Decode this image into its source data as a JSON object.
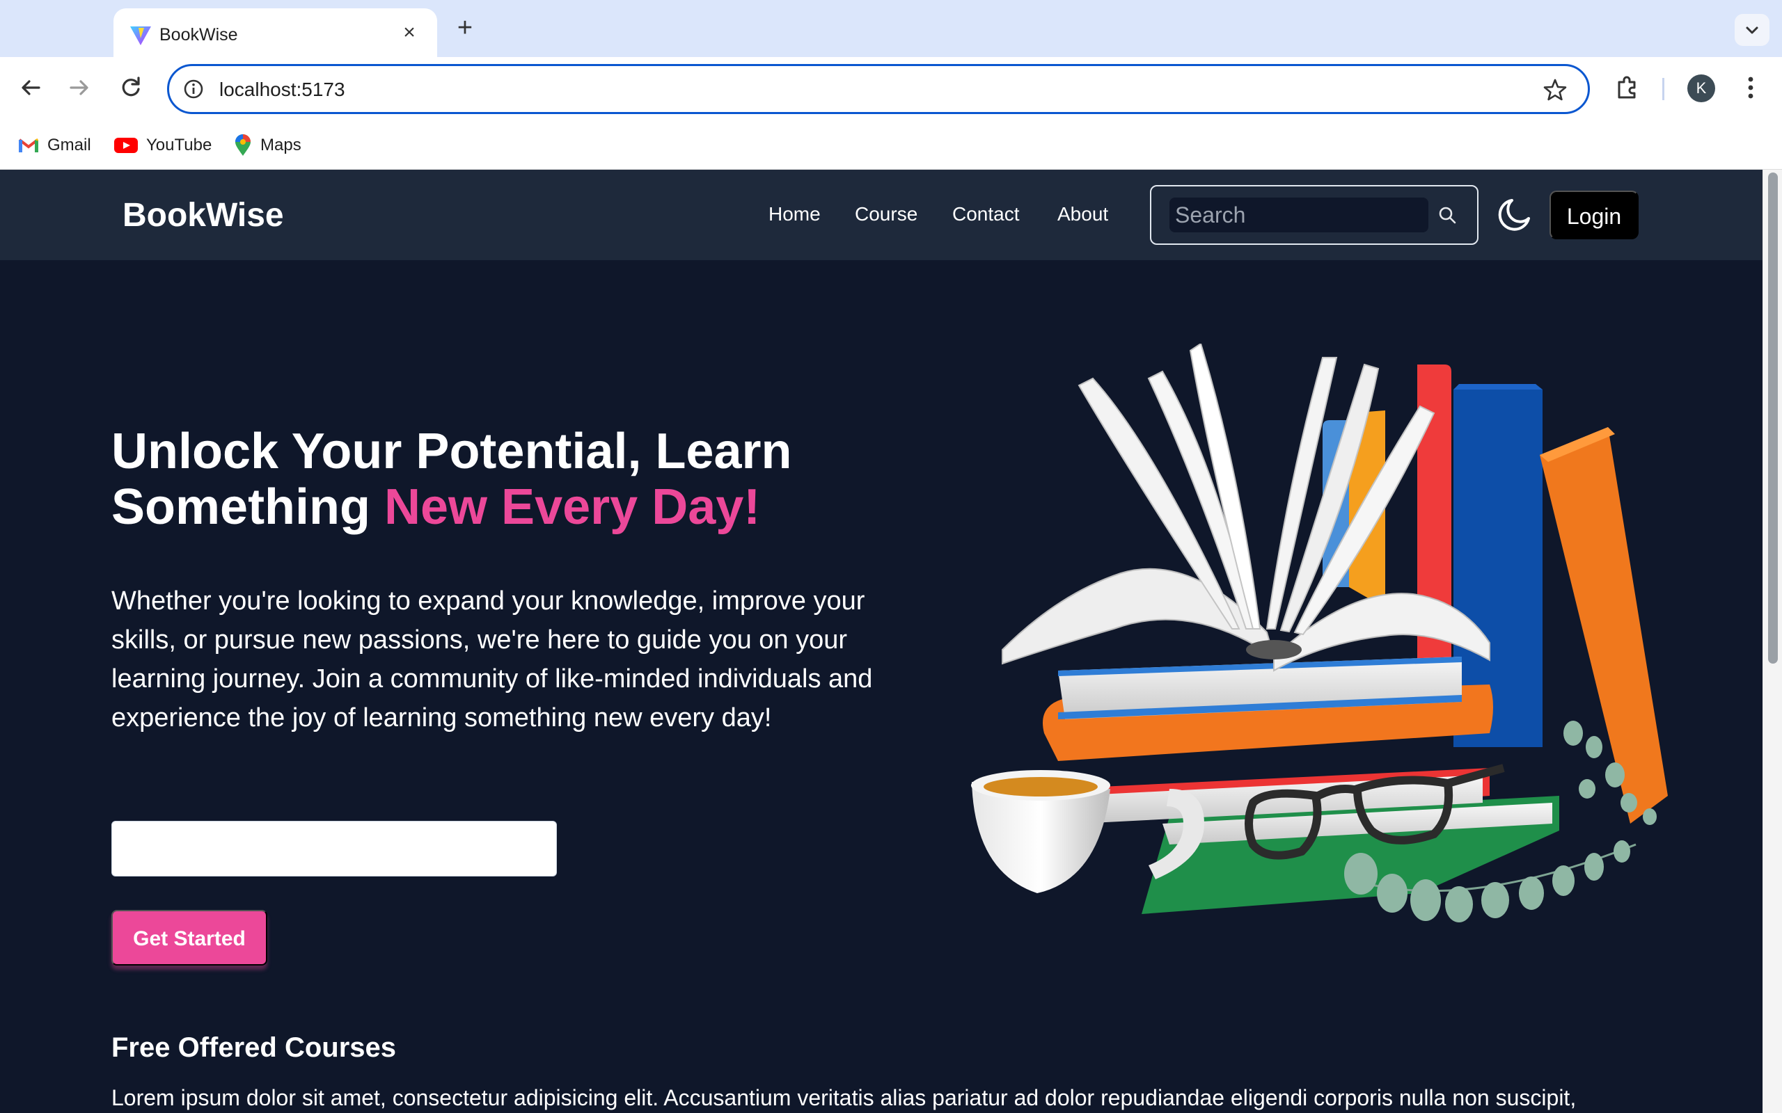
{
  "browser": {
    "tab_title": "BookWise",
    "url": "localhost:5173",
    "profile_initial": "K",
    "bookmarks": [
      {
        "label": "Gmail",
        "icon": "gmail-icon"
      },
      {
        "label": "YouTube",
        "icon": "youtube-icon"
      },
      {
        "label": "Maps",
        "icon": "maps-icon"
      }
    ]
  },
  "site": {
    "brand": "BookWise",
    "nav": [
      "Home",
      "Course",
      "Contact",
      "About"
    ],
    "search_placeholder": "Search",
    "login_label": "Login"
  },
  "hero": {
    "title_plain": "Unlock Your Potential, Learn Something ",
    "title_accent": "New Every Day!",
    "description": "Whether you're looking to expand your knowledge, improve your skills, or pursue new passions, we're here to guide you on your learning journey. Join a community of like-minded individuals and experience the joy of learning something new every day!",
    "email_value": "",
    "cta_label": "Get Started"
  },
  "courses": {
    "title": "Free Offered Courses",
    "text": "Lorem ipsum dolor sit amet, consectetur adipisicing elit. Accusantium veritatis alias pariatur ad dolor repudiandae eligendi corporis nulla non suscipit,"
  },
  "colors": {
    "accent": "#ec4899",
    "page_bg": "#0f172a",
    "navbar_bg": "#1e293b",
    "browser_focus": "#0b57d0"
  },
  "icons": [
    "back-icon",
    "forward-icon",
    "reload-icon",
    "info-icon",
    "star-icon",
    "extensions-icon",
    "kebab-icon",
    "search-icon",
    "moon-icon",
    "close-icon",
    "plus-icon",
    "chevron-down-icon"
  ]
}
